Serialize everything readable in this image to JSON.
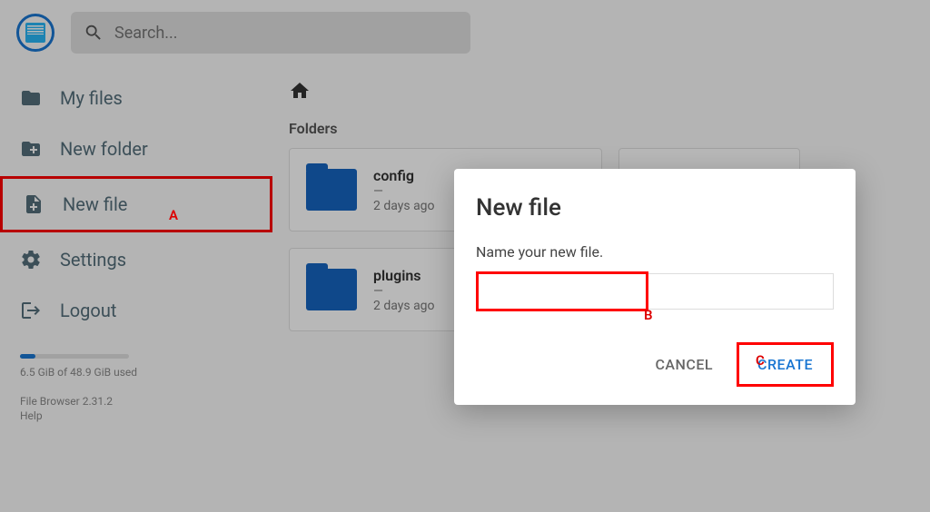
{
  "search": {
    "placeholder": "Search..."
  },
  "sidebar": {
    "items": [
      {
        "label": "My files"
      },
      {
        "label": "New folder"
      },
      {
        "label": "New file"
      },
      {
        "label": "Settings"
      },
      {
        "label": "Logout"
      }
    ],
    "storage_text": "6.5 GiB of 48.9 GiB used",
    "version": "File Browser 2.31.2",
    "help": "Help"
  },
  "content": {
    "section_title": "Folders",
    "folders": [
      {
        "name": "config",
        "dash": "—",
        "time": "2 days ago"
      },
      {
        "name": "plugins",
        "dash": "—",
        "time": "2 days ago"
      }
    ]
  },
  "dialog": {
    "title": "New file",
    "prompt": "Name your new file.",
    "value": "",
    "cancel": "CANCEL",
    "create": "CREATE"
  },
  "annotations": {
    "a": "A",
    "b": "B",
    "c": "C"
  }
}
